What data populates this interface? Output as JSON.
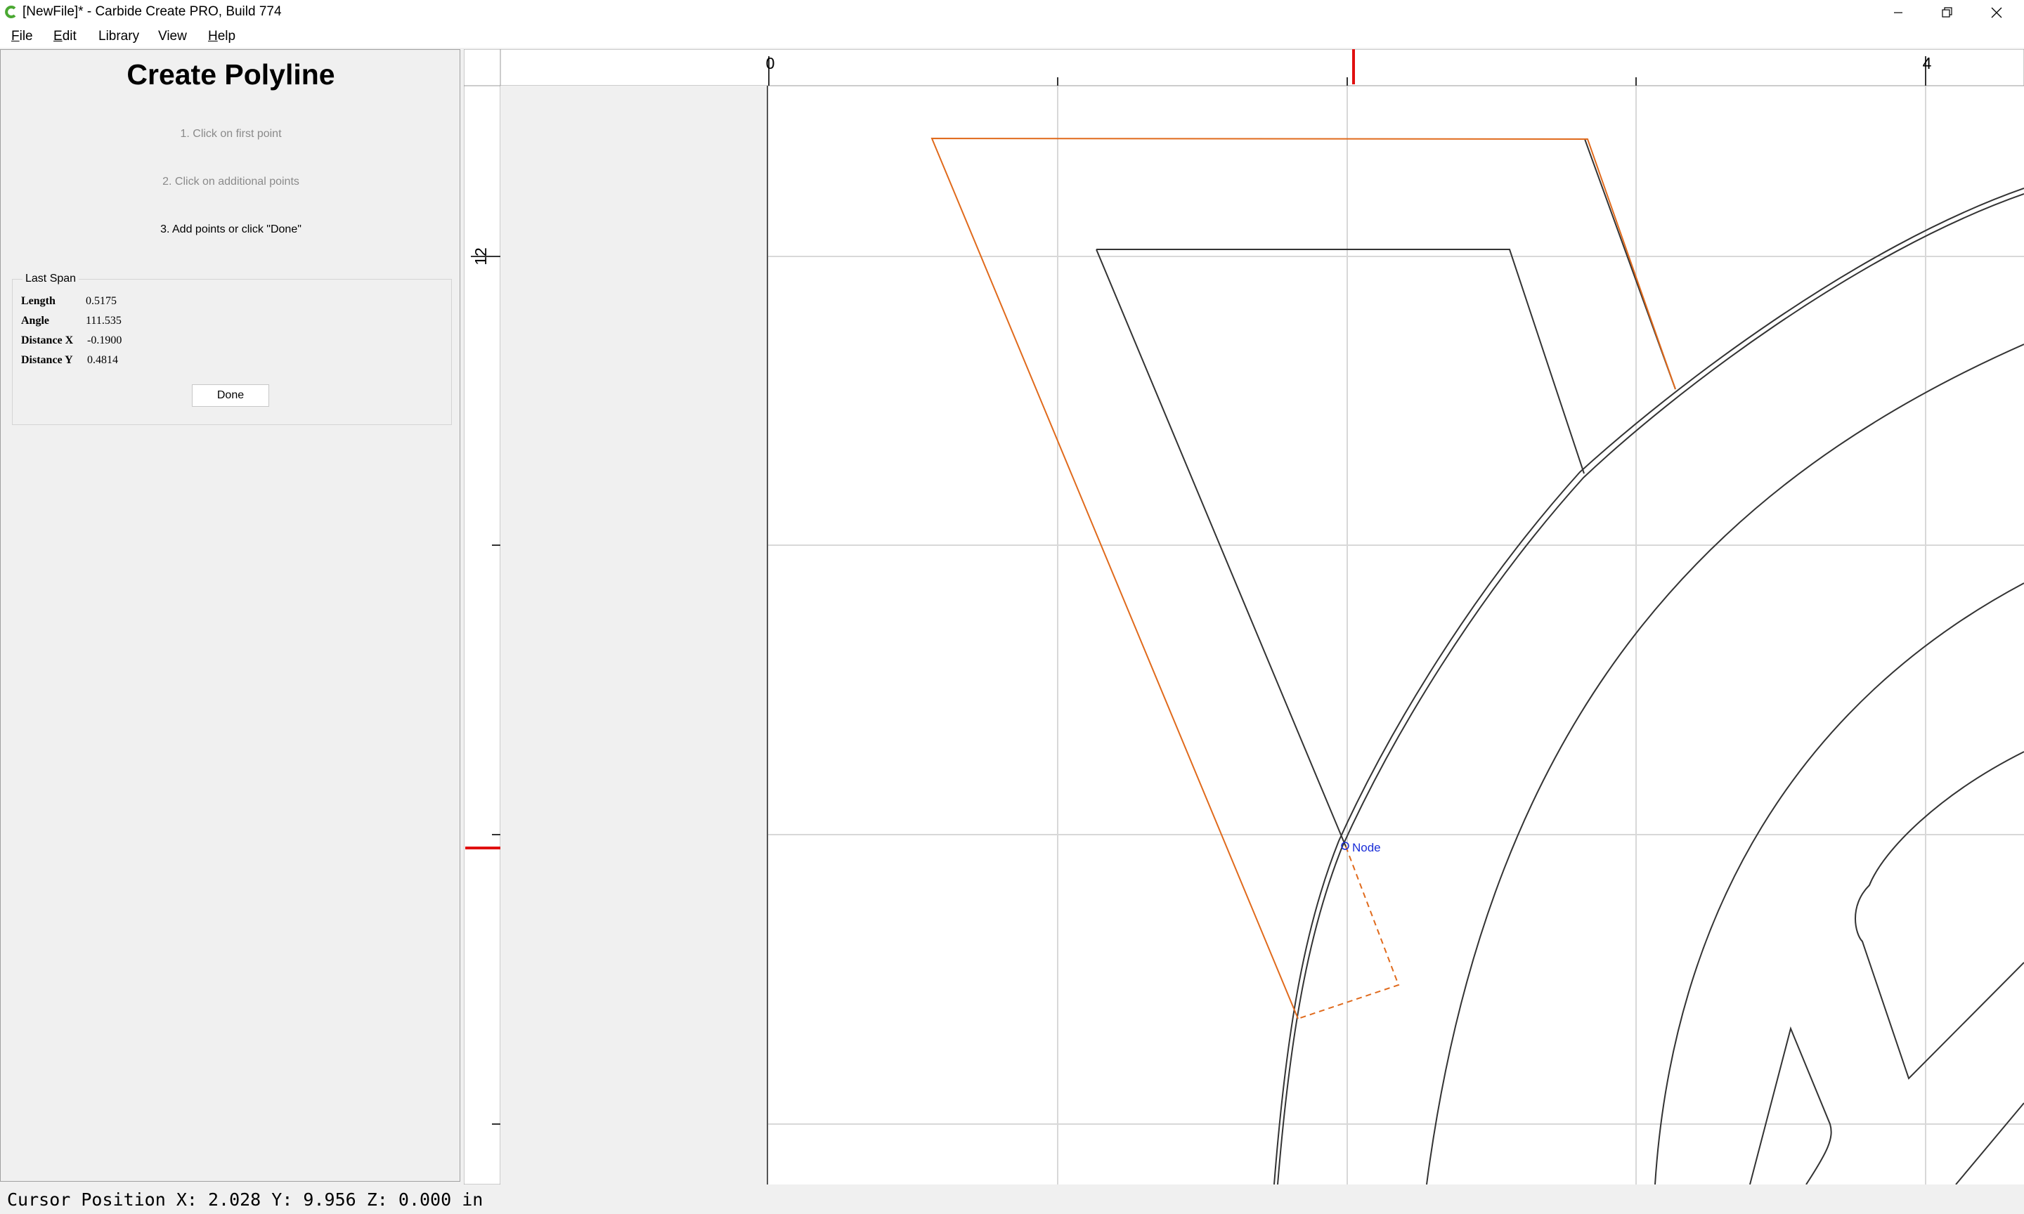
{
  "window": {
    "title": "[NewFile]* - Carbide Create PRO, Build 774",
    "icons": {
      "app": "carbide-logo-icon",
      "minimize": "minimize-icon",
      "restore": "restore-icon",
      "close": "close-icon"
    }
  },
  "menu": [
    {
      "key": "F",
      "rest": "ile"
    },
    {
      "key": "E",
      "rest": "dit"
    },
    {
      "key": "",
      "rest": "Library"
    },
    {
      "key": "",
      "rest": "View"
    },
    {
      "key": "H",
      "rest": "elp"
    }
  ],
  "panel": {
    "title": "Create Polyline",
    "steps": [
      "1. Click on first point",
      "2. Click on additional points",
      "3. Add points or click \"Done\""
    ],
    "last_span": {
      "title": "Last Span",
      "length_label": "Length",
      "length": "0.5175",
      "angle_label": "Angle",
      "angle": "111.535",
      "dx_label": "Distance X",
      "dx": "-0.1900",
      "dy_label": "Distance Y",
      "dy": "0.4814"
    },
    "done_label": "Done"
  },
  "canvas": {
    "ruler_h_labels": [
      "0",
      "4"
    ],
    "ruler_v_labels": [
      "12"
    ],
    "node_label": "Node",
    "colors": {
      "active_polyline": "#e06a1c",
      "geometry": "#333333",
      "node_label": "#1a2ed8",
      "cursor_marker": "#e01010",
      "grid": "#d8d8d8",
      "background": "#ffffff"
    }
  },
  "status": {
    "text": "Cursor Position X: 2.028 Y: 9.956 Z: 0.000 in"
  }
}
